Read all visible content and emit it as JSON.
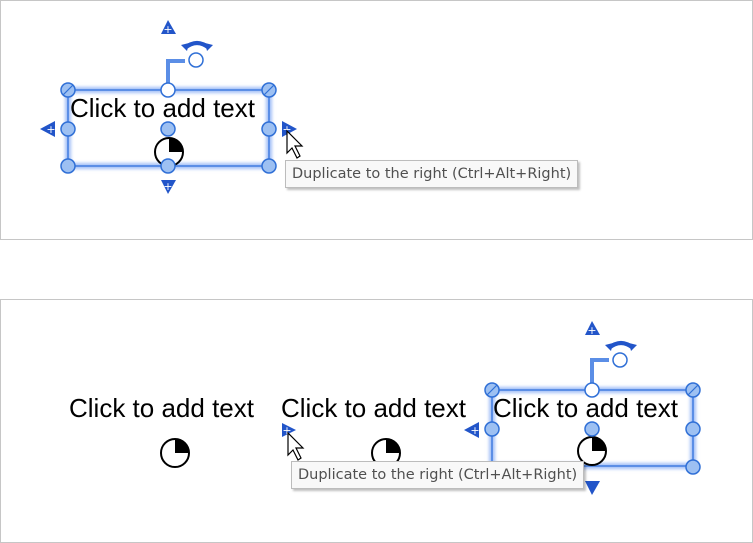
{
  "top_panel": {
    "shape_text": "Click to add text",
    "tooltip": "Duplicate to the right (Ctrl+Alt+Right)"
  },
  "bottom_panel": {
    "shape_texts": [
      "Click to add text",
      "Click to add text",
      "Click to add text"
    ],
    "tooltip": "Duplicate to the right (Ctrl+Alt+Right)"
  },
  "icons": {
    "selection_handle": "circle-handle",
    "duplicate_arrows": "triangle-plus-arrow",
    "rotate": "rotate-arrow-icon",
    "pie_placeholder": "pie-chart-icon",
    "cursor": "mouse-pointer-icon"
  },
  "colors": {
    "handle_fill": "#9dc0f2",
    "handle_stroke": "#2f6fd6",
    "arrow": "#2255c9",
    "panel_border": "#c6c6c6"
  }
}
